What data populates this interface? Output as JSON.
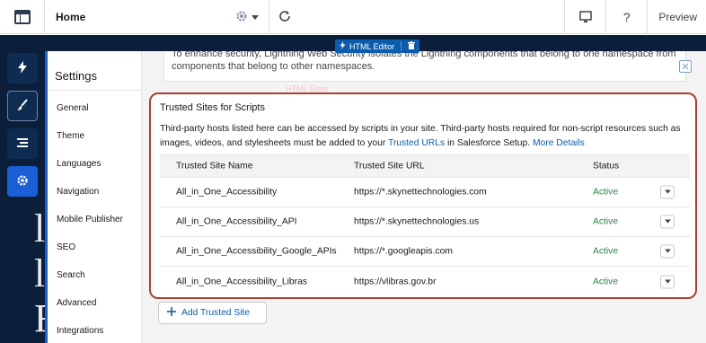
{
  "topbar": {
    "title": "Home",
    "preview_label": "Preview",
    "help_label": "?"
  },
  "rail": {
    "items": [
      {
        "icon": "lightning-icon"
      },
      {
        "icon": "brush-icon"
      },
      {
        "icon": "list-icon"
      },
      {
        "icon": "gear-icon"
      }
    ],
    "bg_chars": [
      "l",
      "l",
      "F"
    ]
  },
  "settings": {
    "title": "Settings",
    "items": [
      "General",
      "Theme",
      "Languages",
      "Navigation",
      "Mobile Publisher",
      "SEO",
      "Search",
      "Advanced",
      "Integrations"
    ]
  },
  "notice": {
    "line1": "To enhance security, Lightning Web Security isolates the Lightning components that belong to one namespace from",
    "line2": "components that belong to other namespaces."
  },
  "editor_tab": {
    "label": "HTML Editor"
  },
  "ghost_label": "HTML Edito",
  "trusted_sites": {
    "title": "Trusted Sites for Scripts",
    "desc_part1": "Third-party hosts listed here can be accessed by scripts in your site. Third-party hosts required for non-script resources such as images, videos, and stylesheets must be added to your ",
    "desc_link1": "Trusted URLs",
    "desc_part2": " in Salesforce Setup. ",
    "desc_link2": "More Details",
    "columns": {
      "name": "Trusted Site Name",
      "url": "Trusted Site URL",
      "status": "Status"
    },
    "rows": [
      {
        "name": "All_in_One_Accessibility",
        "url": "https://*.skynettechnologies.com",
        "status": "Active"
      },
      {
        "name": "All_in_One_Accessibility_API",
        "url": "https://*.skynettechnologies.us",
        "status": "Active"
      },
      {
        "name": "All_in_One_Accessibility_Google_APIs",
        "url": "https://*.googleapis.com",
        "status": "Active"
      },
      {
        "name": "All_in_One_Accessibility_Libras",
        "url": "https://vlibras.gov.br",
        "status": "Active"
      }
    ],
    "add_label": "Add Trusted Site"
  },
  "colors": {
    "navy": "#0b1f3a",
    "accent_blue": "#1b5fd6",
    "link": "#0b5cab",
    "active_green": "#2e844a",
    "highlight_border": "#a84036"
  }
}
